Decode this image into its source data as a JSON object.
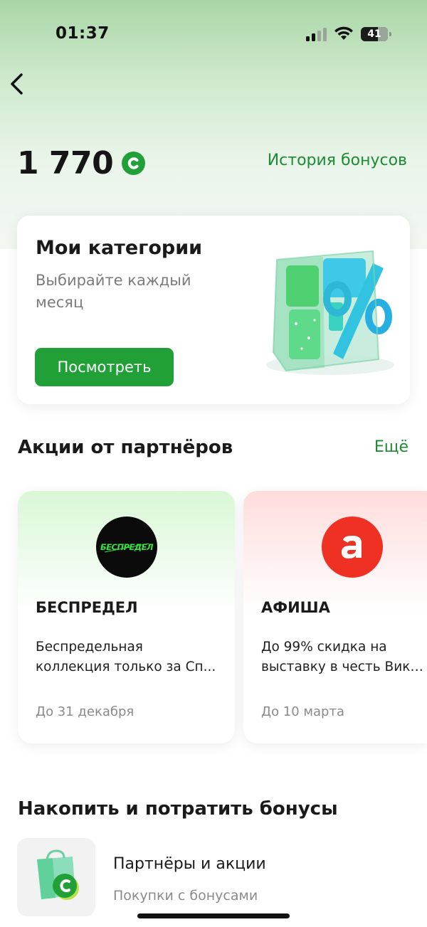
{
  "status_bar": {
    "time": "01:37",
    "battery": "41"
  },
  "header": {
    "back_icon": "chevron-left-icon"
  },
  "balance": {
    "value": "1 770",
    "currency_icon": "bonus-c-icon",
    "history_label": "История бонусов"
  },
  "categories": {
    "title": "Мои категории",
    "subtitle": "Выбирайте каждый месяц",
    "button_label": "Посмотреть",
    "illustration": "percent-gift-illustration"
  },
  "partners": {
    "title": "Акции от партнёров",
    "more_label": "Ещё",
    "cards": [
      {
        "name": "БЕСПРЕДЕЛ",
        "logo_text": "БЕСПРЕДЕЛ",
        "description_line1": "Беспредельная",
        "description_line2": "коллекция только за Сп...",
        "date": "До 31 декабря",
        "accent": "#c6f5c6"
      },
      {
        "name": "АФИША",
        "logo_text": "a",
        "description_line1": "До 99% скидка на",
        "description_line2": "выставку в честь Викто...",
        "date": "До 10 марта",
        "accent": "#ffd6d6"
      }
    ]
  },
  "earn_spend": {
    "title": "Накопить и потратить бонусы",
    "items": [
      {
        "title": "Партнёры и акции",
        "subtitle": "Покупки с бонусами",
        "icon": "shopping-bag-bonus-icon"
      }
    ]
  },
  "colors": {
    "accent_green": "#21a038",
    "link_green": "#1f8a36",
    "afisha_red": "#ef3124"
  }
}
